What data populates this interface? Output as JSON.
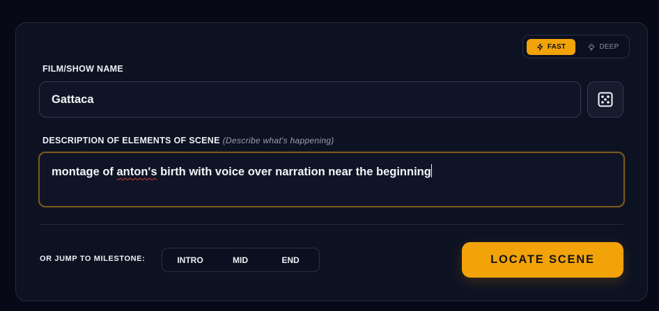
{
  "mode": {
    "fast_label": "FAST",
    "deep_label": "DEEP",
    "selected": "FAST",
    "accent_color": "#f2a30a"
  },
  "film": {
    "label": "FILM/SHOW NAME",
    "value": "Gattaca",
    "randomize_icon": "dice-icon"
  },
  "description": {
    "label": "DESCRIPTION OF ELEMENTS OF SCENE",
    "hint": "(Describe what's happening)",
    "value_before": "montage of ",
    "value_misspelled": "anton's",
    "value_after": " birth with voice over narration near the beginning"
  },
  "milestones": {
    "label": "OR JUMP TO MILESTONE:",
    "items": [
      "INTRO",
      "MID",
      "END"
    ]
  },
  "actions": {
    "locate_label": "LOCATE SCENE"
  }
}
